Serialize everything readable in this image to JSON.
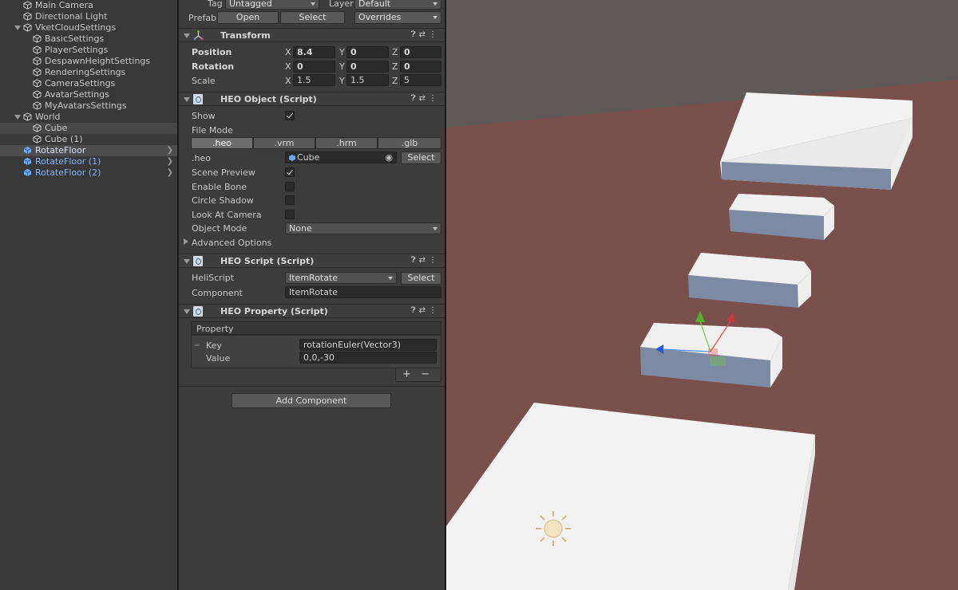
{
  "hierarchy": {
    "items": [
      {
        "label": "Main Camera"
      },
      {
        "label": "Directional Light"
      },
      {
        "label": "VketCloudSettings"
      },
      {
        "label": "BasicSettings"
      },
      {
        "label": "PlayerSettings"
      },
      {
        "label": "DespawnHeightSettings"
      },
      {
        "label": "RenderingSettings"
      },
      {
        "label": "CameraSettings"
      },
      {
        "label": "AvatarSettings"
      },
      {
        "label": "MyAvatarsSettings"
      },
      {
        "label": "World"
      },
      {
        "label": "Cube"
      },
      {
        "label": "Cube (1)"
      },
      {
        "label": "RotateFloor"
      },
      {
        "label": "RotateFloor (1)"
      },
      {
        "label": "RotateFloor (2)"
      }
    ]
  },
  "inspector": {
    "tag_label": "Tag",
    "tag_value": "Untagged",
    "layer_label": "Layer",
    "layer_value": "Default",
    "prefab_label": "Prefab",
    "open_btn": "Open",
    "select_btn": "Select",
    "overrides": "Overrides",
    "transform": {
      "title": "Transform",
      "position_label": "Position",
      "rotation_label": "Rotation",
      "scale_label": "Scale",
      "x": "X",
      "y": "Y",
      "z": "Z",
      "position": [
        "8.4",
        "0",
        "0"
      ],
      "rotation": [
        "0",
        "0",
        "0"
      ],
      "scale": [
        "1.5",
        "1.5",
        "5"
      ]
    },
    "heo_object": {
      "title": "HEO Object (Script)",
      "show_label": "Show",
      "file_mode_label": "File Mode",
      "modes": [
        ".heo",
        ".vrm",
        ".hrm",
        ".glb"
      ],
      "heo_label": ".heo",
      "heo_value": "Cube",
      "select_btn": "Select",
      "scene_preview_label": "Scene Preview",
      "enable_bone_label": "Enable Bone",
      "circle_shadow_label": "Circle Shadow",
      "look_at_camera_label": "Look At Camera",
      "object_mode_label": "Object Mode",
      "object_mode_value": "None",
      "advanced_label": "Advanced Options"
    },
    "heo_script": {
      "title": "HEO Script (Script)",
      "heliscript_label": "HeliScript",
      "heliscript_value": "ItemRotate",
      "select_btn": "Select",
      "component_label": "Component",
      "component_value": "ItemRotate"
    },
    "heo_property": {
      "title": "HEO Property (Script)",
      "property_label": "Property",
      "key_label": "Key",
      "key_value": "rotationEuler(Vector3)",
      "value_label": "Value",
      "value_value": "0,0,-30",
      "plus": "+",
      "minus": "−"
    },
    "add_component": "Add Component"
  },
  "colors": {
    "panel_bg": "#383838",
    "inspector_bg": "#3c3c3c",
    "scene_sky": "#5f5a58",
    "scene_floor": "#7a504c",
    "highlight_blue": "#7fb5ff"
  }
}
